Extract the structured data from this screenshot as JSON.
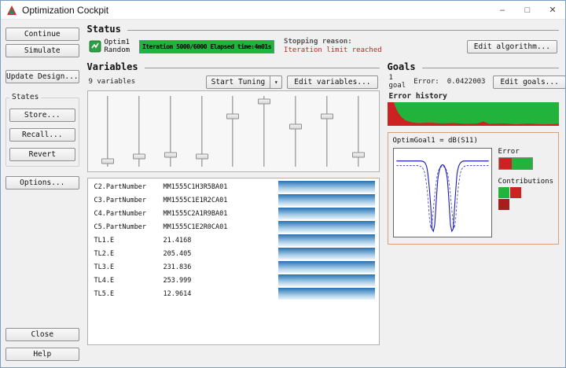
{
  "window": {
    "title": "Optimization Cockpit"
  },
  "icons": {
    "minimize": "–",
    "maximize": "□",
    "close": "✕",
    "dropdown_arrow": "▾"
  },
  "sidebar": {
    "continue_label": "Continue",
    "simulate_label": "Simulate",
    "update_design_label": "Update Design...",
    "states_label": "States",
    "store_label": "Store...",
    "recall_label": "Recall...",
    "revert_label": "Revert",
    "options_label": "Options...",
    "close_label": "Close",
    "help_label": "Help"
  },
  "status": {
    "heading": "Status",
    "optim_name": "Optim1",
    "optim_type": "Random",
    "progress_text": "Iteration 5000/6000  Elapsed time:4m01s",
    "stopping_reason_label": "Stopping reason:",
    "stopping_reason_value": "Iteration limit reached",
    "edit_algorithm_label": "Edit algorithm..."
  },
  "variables": {
    "heading": "Variables",
    "count_text": "9 variables",
    "tuning_button_label": "Start Tuning",
    "edit_button_label": "Edit variables...",
    "sliders": [
      90,
      84,
      82,
      84,
      30,
      10,
      44,
      30,
      82
    ],
    "rows": [
      {
        "name": "C2.PartNumber",
        "value": "MM1555C1H3R5BA01"
      },
      {
        "name": "C3.PartNumber",
        "value": "MM1555C1E1R2CA01"
      },
      {
        "name": "C4.PartNumber",
        "value": "MM1555C2A1R9BA01"
      },
      {
        "name": "C5.PartNumber",
        "value": "MM1555C1E2R0CA01"
      },
      {
        "name": "TL1.E",
        "value": "21.4168"
      },
      {
        "name": "TL2.E",
        "value": "205.405"
      },
      {
        "name": "TL3.E",
        "value": "231.836"
      },
      {
        "name": "TL4.E",
        "value": "253.999"
      },
      {
        "name": "TL5.E",
        "value": "12.9614"
      }
    ]
  },
  "goals": {
    "heading": "Goals",
    "count_text": "1 goal",
    "error_label": "Error:",
    "error_value": "0.0422003",
    "edit_button_label": "Edit goals...",
    "history_label": "Error history",
    "goal_title": "OptimGoal1 = dB(S11)",
    "plot_error_label": "Error",
    "contributions_label": "Contributions"
  },
  "colors": {
    "accent_green": "#22b33c",
    "accent_red": "#cc2222",
    "trace_blue": "#1a1ab0",
    "bar_blue_dark": "#2a6fae",
    "bar_blue_light": "#e9f4fb"
  }
}
